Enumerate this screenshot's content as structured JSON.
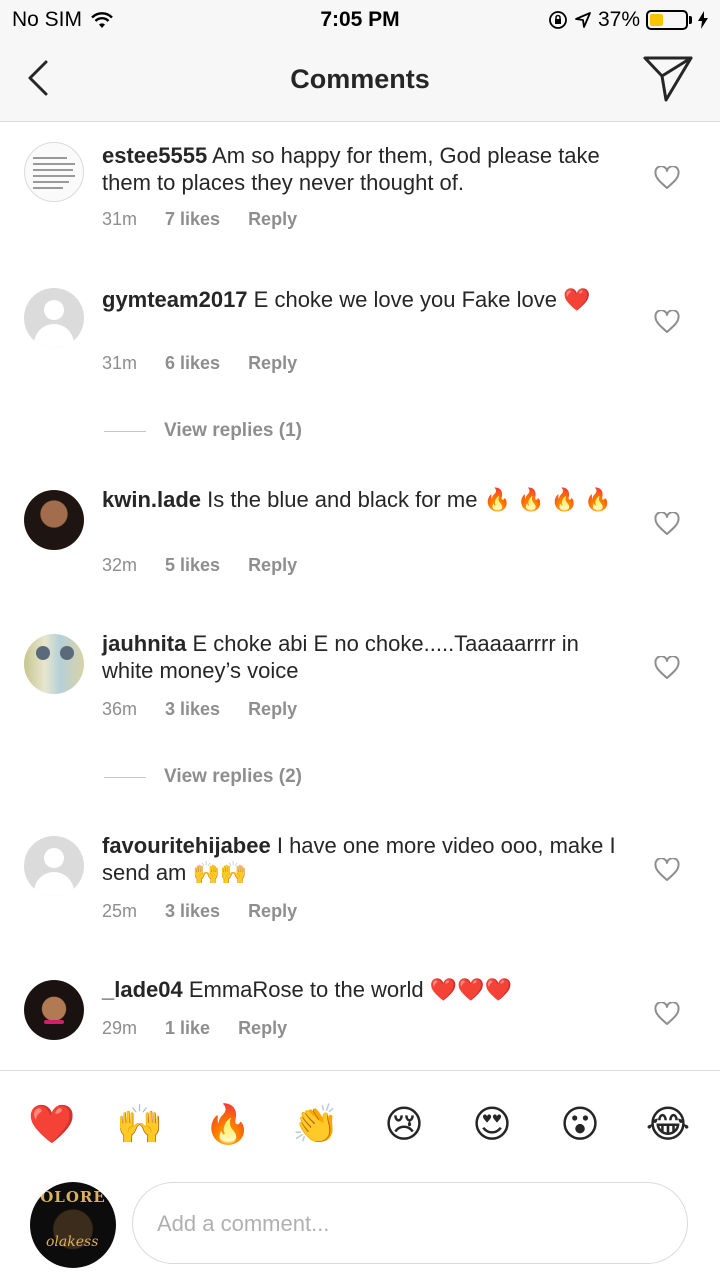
{
  "status_bar": {
    "carrier": "No SIM",
    "time": "7:05 PM",
    "battery": "37%",
    "battery_level": 0.37,
    "battery_color": "#f7c500"
  },
  "header": {
    "title": "Comments",
    "back_icon": "chevron-left-icon",
    "send_icon": "paper-plane-icon"
  },
  "comments": [
    {
      "username": "estee5555",
      "text": "Am so happy for them, God please take them to places they never thought of.",
      "time": "31m",
      "likes": "7 likes",
      "reply": "Reply",
      "avatar": "document-image"
    },
    {
      "username": "gymteam2017",
      "text": "E choke we love you Fake love ❤️",
      "time": "31m",
      "likes": "6 likes",
      "reply": "Reply",
      "avatar": "default"
    },
    {
      "username": "kwin.lade",
      "text": "Is the blue and black for me 🔥 🔥 🔥 🔥",
      "time": "32m",
      "likes": "5 likes",
      "reply": "Reply",
      "avatar": "photo"
    },
    {
      "username": "jauhnita",
      "text": "E choke abi E no choke.....Taaaaarrrr in white money’s voice",
      "time": "36m",
      "likes": "3 likes",
      "reply": "Reply",
      "avatar": "photo"
    },
    {
      "username": "favouritehijabee",
      "text": "I have one more video ooo, make I send am 🙌🙌",
      "time": "25m",
      "likes": "3 likes",
      "reply": "Reply",
      "avatar": "default"
    },
    {
      "username": "_lade04",
      "text": "EmmaRose to the world ❤️❤️❤️",
      "time": "29m",
      "likes": "1 like",
      "reply": "Reply",
      "avatar": "photo"
    }
  ],
  "view_replies": [
    {
      "label": "View replies (1)"
    },
    {
      "label": "View replies (2)"
    }
  ],
  "emoji_bar": [
    "❤️",
    "🙌",
    "🔥",
    "👏",
    "😢",
    "😍",
    "😮",
    "😂"
  ],
  "composer": {
    "placeholder": "Add a comment...",
    "avatar_text": "OLORE",
    "avatar_signature": "olakess"
  },
  "colors": {
    "text": "#262626",
    "secondary": "#8e8e8e",
    "border": "#dbdbdb"
  }
}
